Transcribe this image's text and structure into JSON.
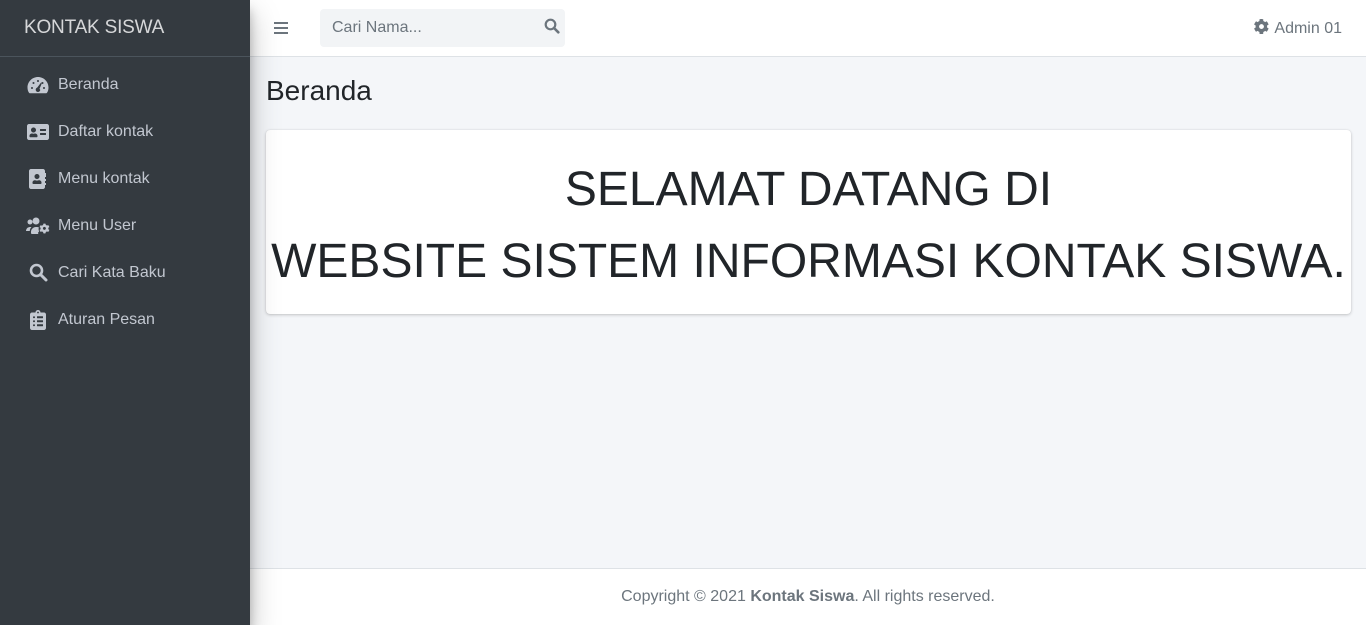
{
  "sidebar": {
    "brand": "KONTAK SISWA",
    "items": [
      {
        "label": "Beranda",
        "icon": "tachometer-icon"
      },
      {
        "label": "Daftar kontak",
        "icon": "id-card-icon"
      },
      {
        "label": "Menu kontak",
        "icon": "address-book-icon"
      },
      {
        "label": "Menu User",
        "icon": "users-cog-icon"
      },
      {
        "label": "Cari Kata Baku",
        "icon": "search-icon"
      },
      {
        "label": "Aturan Pesan",
        "icon": "clipboard-list-icon"
      }
    ]
  },
  "navbar": {
    "menu_icon": "hamburger-icon",
    "search_placeholder": "Cari Nama...",
    "search_icon": "search-icon",
    "user_label": "Admin 01",
    "user_icon": "gear-icon"
  },
  "main": {
    "page_title": "Beranda",
    "welcome_line1": "SELAMAT DATANG DI",
    "welcome_line2": "WEBSITE SISTEM INFORMASI KONTAK SISWA."
  },
  "footer": {
    "prefix": "Copyright © 2021 ",
    "brand": "Kontak Siswa",
    "suffix": ". All rights reserved."
  },
  "colors": {
    "sidebar_bg": "#343a40",
    "sidebar_text": "#c2c7d0",
    "content_bg": "#f4f6f9",
    "muted": "#6c757d"
  }
}
